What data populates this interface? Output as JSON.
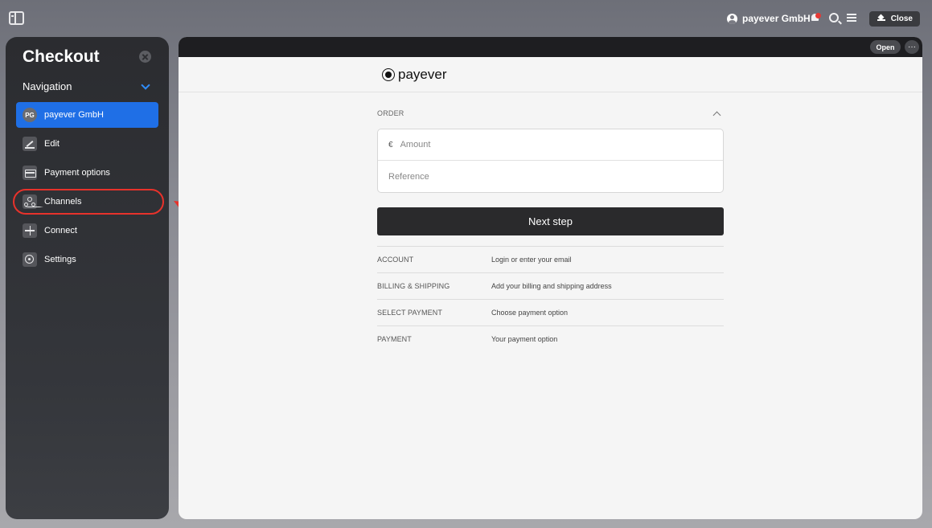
{
  "topbar": {
    "account_name": "payever GmbH",
    "close_label": "Close",
    "notification_color": "#e53935"
  },
  "sidebar": {
    "title": "Checkout",
    "nav_header": "Navigation",
    "accent_color": "#1f6fe6",
    "items": [
      {
        "label": "payever GmbH",
        "icon": "avatar",
        "avatar_initials": "PG",
        "active": true
      },
      {
        "label": "Edit",
        "icon": "edit-icon",
        "active": false
      },
      {
        "label": "Payment options",
        "icon": "card-icon",
        "active": false
      },
      {
        "label": "Channels",
        "icon": "channels-icon",
        "active": false,
        "highlighted": true
      },
      {
        "label": "Connect",
        "icon": "plus-icon",
        "active": false
      },
      {
        "label": "Settings",
        "icon": "settings-icon",
        "active": false
      }
    ]
  },
  "annotation": {
    "color": "#e8322b"
  },
  "panel": {
    "open_label": "Open",
    "more_label": "···"
  },
  "checkout": {
    "brand": "payever",
    "order_label": "ORDER",
    "currency_symbol": "€",
    "amount_placeholder": "Amount",
    "reference_placeholder": "Reference",
    "next_step_label": "Next step",
    "steps": [
      {
        "name": "ACCOUNT",
        "description": "Login or enter your email"
      },
      {
        "name": "BILLING & SHIPPING",
        "description": "Add your billing and shipping address"
      },
      {
        "name": "SELECT PAYMENT",
        "description": "Choose payment option"
      },
      {
        "name": "PAYMENT",
        "description": "Your payment option"
      }
    ]
  }
}
